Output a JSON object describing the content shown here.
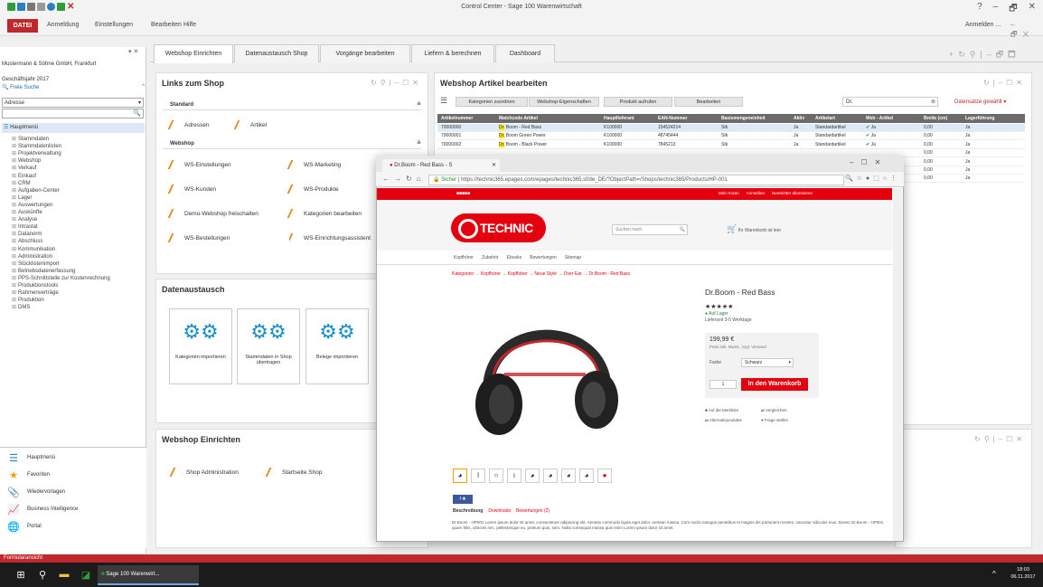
{
  "window": {
    "title": "Control Center - Sage 100 Warenwirtschaft",
    "help": "?",
    "minimize": "–",
    "maximize": "🗗",
    "close": "✕"
  },
  "menu": {
    "file": "DATEI",
    "items": [
      "Anmeldung",
      "Einstellungen",
      "Bearbeiten",
      "Hilfe"
    ],
    "login": "Anmelden ..."
  },
  "sidebar": {
    "company": "Mustermann & Söhne GmbH, Frankfurt",
    "year": "Geschäftsjahr 2017",
    "search_label": "Freie Suche",
    "search_type": "Adresse",
    "tree_root": "Hauptmenü",
    "tree": [
      "Stammdaten",
      "Stammdatenlisten",
      "Projektverwaltung",
      "Webshop",
      "Verkauf",
      "Einkauf",
      "CRM",
      "Aufgaben-Center",
      "Lager",
      "Auswertungen",
      "Auskünfte",
      "Analyse",
      "Intrastat",
      "Datanorm",
      "Abschluss",
      "Kommunikation",
      "Administration",
      "Stücklistenimport",
      "Betriebsdatenerfassung",
      "PPS-Schnittstelle zur Kostenrechnung",
      "Produktionstools",
      "Rahmenverträge",
      "Produktion",
      "DMS"
    ],
    "nav": [
      "Hauptmenü",
      "Favoriten",
      "Wiedervorlagen",
      "Business Intelligence",
      "Portal"
    ]
  },
  "tabs": [
    "Webshop Einrichten",
    "Datenaustausch Shop",
    "Vorgänge bearbeiten",
    "Liefern & berechnen",
    "Dashboard"
  ],
  "links_panel": {
    "title": "Links zum Shop",
    "standard": "Standard",
    "standard_links": [
      "Adressen",
      "Artikel"
    ],
    "webshop": "Webshop",
    "webshop_links": [
      "WS-Einstellungen",
      "WS-Marketing",
      "WS-Kunden",
      "WS-Produkte",
      "Demo-Webshop freischalten",
      "Kategorien bearbeiten",
      "WS-Bestellungen",
      "WS-Einrichtungsassistent"
    ]
  },
  "exchange_panel": {
    "title": "Datenaustausch",
    "tiles": [
      "Kategorien importieren",
      "Stammdaten in Shop übertragen",
      "Belege importieren"
    ]
  },
  "setup_panel": {
    "title": "Webshop Einrichten",
    "links": [
      "Shop Administration",
      "Startseite Shop"
    ]
  },
  "articles_panel": {
    "title": "Webshop Artikel bearbeiten",
    "buttons": [
      "Kategorien zuordnen",
      "Webshop-Eigenschaften",
      "Produkt aufrufen",
      "Bearbeiten"
    ],
    "filter": "Dr.",
    "view": "Datensätze gewählt",
    "columns": [
      "Artikelnummer",
      "Matchcode Artikel",
      "Hauptlieferant",
      "EAN-Nummer",
      "Basismengeneinheit",
      "Aktiv",
      "Artikelart",
      "Web - Artikel",
      "Breite (cm)",
      "Lagerführung"
    ],
    "rows": [
      [
        "70000000",
        "Dr. Boom - Red Bass",
        "K100000",
        "154524214",
        "Stk",
        "Ja",
        "Standardartikel",
        "Ja",
        "0,00",
        "Ja"
      ],
      [
        "70000001",
        "Dr. Boom Green Power",
        "K100000",
        "48745444",
        "Stk",
        "Ja",
        "Standardartikel",
        "Ja",
        "0,00",
        "Ja"
      ],
      [
        "70000002",
        "Dr. Boom - Black Power",
        "K100000",
        "7845213",
        "Stk",
        "Ja",
        "Standardartikel",
        "Ja",
        "0,00",
        "Ja"
      ],
      [
        "",
        "",
        "",
        "",
        "",
        "",
        "",
        "",
        "0,00",
        "Ja"
      ],
      [
        "",
        "",
        "",
        "",
        "",
        "",
        "",
        "",
        "0,00",
        "Ja"
      ],
      [
        "",
        "",
        "",
        "",
        "",
        "",
        "",
        "",
        "0,00",
        "Ja"
      ],
      [
        "",
        "",
        "",
        "",
        "",
        "",
        "",
        "",
        "0,00",
        "Ja"
      ]
    ]
  },
  "browser": {
    "tab_title": "Dr.Boom - Red Bass - S",
    "secure": "Sicher",
    "url": "https://technic365.epages.com/epages/technic365.sf/de_DE/?ObjectPath=/Shops/technic365/Products/HP-001",
    "topbar": [
      "Mein Konto",
      "Anmelden",
      "Newsletter abonnieren"
    ],
    "logo": "TECHNIC 365",
    "search_placeholder": "Suchen nach",
    "cart": "Ihr Warenkorb ist leer",
    "nav": [
      "Kopfhörer",
      "Zubehör",
      "Ebooks",
      "Bewertungen",
      "Sitemap"
    ],
    "breadcrumb": "Kategorien → Kopfhörer → Kopfhörer → Neue Style → Over Ear → Dr.Boom - Red Bass",
    "product": "Dr.Boom - Red Bass",
    "stock": "Auf Lager",
    "delivery": "Lieferzeit 3-5 Werktage",
    "price": "199,99 €",
    "price_note": "Preis inkl. MwSt., zzgl. Versand",
    "color_label": "Farbe",
    "color_value": "Schwarz",
    "qty": "1",
    "cart_button": "In den Warenkorb",
    "actions": [
      "Auf die Merkliste",
      "Vergleichen",
      "Alternativprodukte",
      "Frage stellen"
    ],
    "share": "f ✚",
    "desc_tabs": [
      "Beschreibung",
      "Downloads",
      "Bewertungen (2)"
    ],
    "desc": "Dr.Boom - HP001 Lorem ipsum dolor sit amet, consectetuer adipiscing elit. Aenean commodo ligula eget dolor. Aenean massa. Cum sociis natoque penatibus et magnis dis parturient montes, nascetur ridiculus mus. Donec Dr.Boom - HP001 quam felis, ultricies nec, pellentesque eu, pretium quis, sem. Nulla consequat massa quis enim Lorem ipsum dolor sit amet."
  },
  "statusbar": "Formularansicht",
  "taskbar": {
    "app": "Sage 100 Warenwirt...",
    "time": "18:03",
    "date": "06.11.2017"
  },
  "colors": {
    "accent": "#c0282e",
    "shop_red": "#e4000f",
    "gear": "#1a8fce",
    "grid_head": "#6b6b6b",
    "highlight": "#ffe600"
  }
}
